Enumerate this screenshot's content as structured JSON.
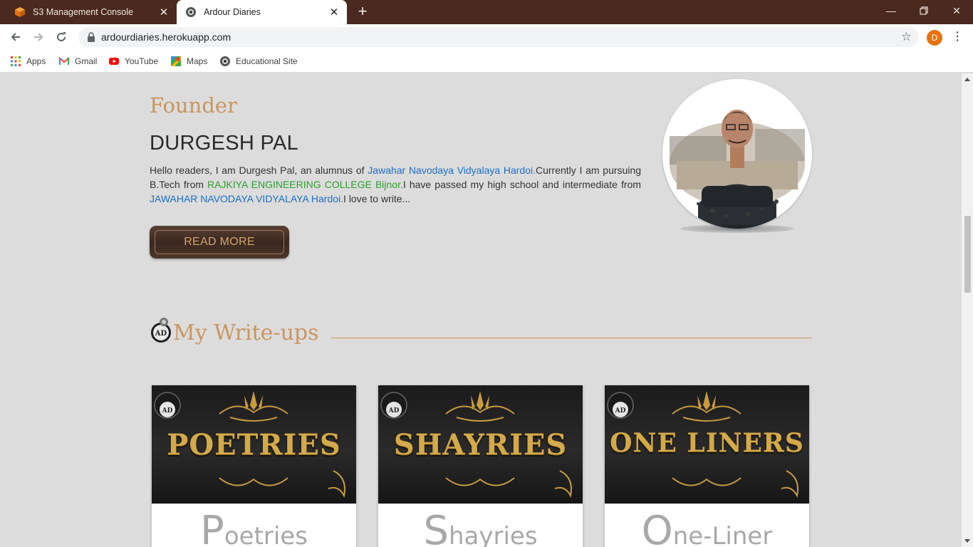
{
  "browser": {
    "tabs": [
      {
        "title": "S3 Management Console",
        "active": false
      },
      {
        "title": "Ardour Diaries",
        "active": true
      }
    ],
    "url": "ardourdiaries.herokuapp.com",
    "profile_initial": "D",
    "bookmarks": [
      {
        "label": "Apps",
        "icon": "apps-grid-icon"
      },
      {
        "label": "Gmail",
        "icon": "gmail-icon"
      },
      {
        "label": "YouTube",
        "icon": "youtube-icon"
      },
      {
        "label": "Maps",
        "icon": "maps-icon"
      },
      {
        "label": "Educational Site",
        "icon": "educational-site-icon"
      }
    ]
  },
  "founder": {
    "heading": "Founder",
    "name": "DURGESH PAL",
    "bio_1": "Hello readers, I am Durgesh Pal, an alumnus of ",
    "bio_link_1": "Jawahar Navodaya Vidyalaya Hardoi.",
    "bio_2": "Currently I am pursuing B.Tech from ",
    "bio_link_2": "RAJKIYA ENGINEERING COLLEGE Bijnor.",
    "bio_3": "I have passed my high school and intermediate from ",
    "bio_link_3": "JAWAHAR NAVODAYA VIDYALAYA Hardoi.",
    "bio_4": "I love to write...",
    "read_more_label": "READ MORE"
  },
  "writeups": {
    "title": "My Write-ups",
    "cards": [
      {
        "banner": "POETRIES",
        "caption_first": "P",
        "caption_rest": "oetries"
      },
      {
        "banner": "SHAYRIES",
        "caption_first": "S",
        "caption_rest": "hayries"
      },
      {
        "banner": "ONE LINERS",
        "caption_first": "O",
        "caption_rest": "ne-Liner"
      }
    ]
  },
  "colors": {
    "tabbar": "#4a2a1e",
    "accent_gold": "#c9965f",
    "link_blue": "#1a6ec7",
    "link_green": "#2e9f2e",
    "page_bg": "#dcdcdc"
  }
}
